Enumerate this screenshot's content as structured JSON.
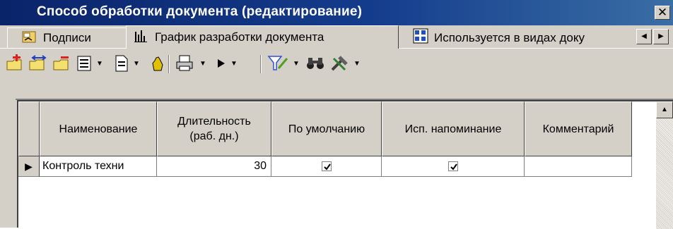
{
  "window": {
    "title": "Способ обработки документа (редактирование)",
    "close_label": "✕"
  },
  "tabs": [
    {
      "label": "Подписи",
      "icon": "signature-icon",
      "active": false
    },
    {
      "label": "График разработки документа",
      "icon": "bar-chart-icon",
      "active": true
    },
    {
      "label": "Используется в видах доку",
      "icon": "document-types-icon",
      "active": false
    }
  ],
  "tab_scroll": {
    "left": "◀",
    "right": "▶"
  },
  "toolbar": {
    "items": [
      "add-record-icon",
      "copy-record-icon",
      "delete-record-icon",
      "form-view-icon",
      "document-icon",
      "hand-icon",
      "print-icon",
      "run-icon",
      "filter-icon",
      "binoculars-icon",
      "tools-icon"
    ]
  },
  "grid": {
    "columns": [
      {
        "label": "Наименование"
      },
      {
        "label": "Длительность\n(раб. дн.)"
      },
      {
        "label": "По умолчанию"
      },
      {
        "label": "Исп. напоминание"
      },
      {
        "label": "Комментарий"
      }
    ],
    "rows": [
      {
        "name": "Контроль техни",
        "duration": "30",
        "default": true,
        "reminder": true,
        "comment": ""
      }
    ],
    "row_indicator": "▶"
  },
  "colors": {
    "title_bar": "#0a246a",
    "face": "#d4d0c8",
    "grid_bg": "#ffffff"
  }
}
